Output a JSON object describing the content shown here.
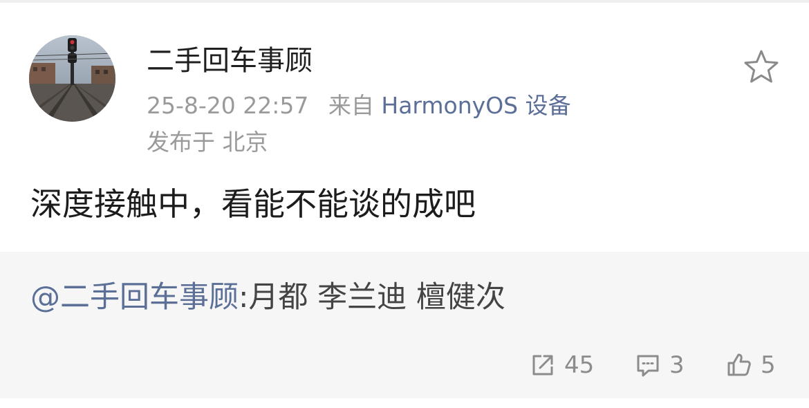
{
  "post": {
    "username": "二手回车事顾",
    "timestamp": "25-8-20 22:57",
    "source_prefix": "来自",
    "device": "HarmonyOS 设备",
    "location": "发布于 北京",
    "text": "深度接触中，看能不能谈的成吧"
  },
  "repost": {
    "mention": "@二手回车事顾",
    "text": ":月都 李兰迪 檀健次"
  },
  "actions": {
    "share_count": "45",
    "comment_count": "3",
    "like_count": "5"
  },
  "icons": {
    "favorite": "star-outline-icon",
    "share": "share-arrow-icon",
    "comment": "comment-bubble-icon",
    "like": "thumbs-up-icon"
  },
  "colors": {
    "link": "#5b6f97",
    "meta_gray": "#9a9a9a",
    "repost_background": "#f6f6f6"
  }
}
